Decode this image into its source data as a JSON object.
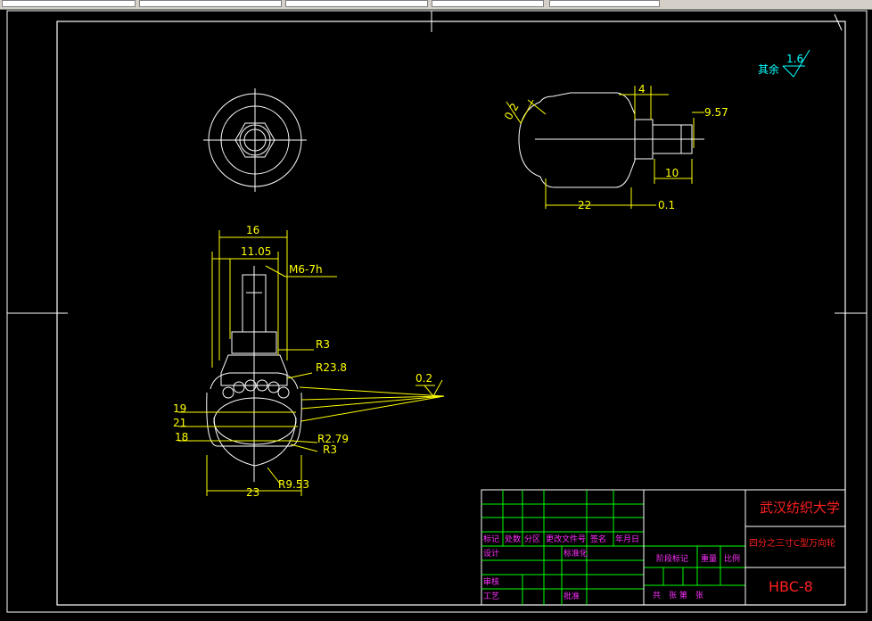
{
  "toolbar": {
    "cells": 6
  },
  "colors": {
    "background": "#000000",
    "outline": "#ffffff",
    "dimension": "#ffff00",
    "title_red": "#ff2020",
    "title_magenta": "#ff30ff",
    "table_line": "#00ff00",
    "cyan": "#00ffff"
  },
  "roughness": {
    "label": "其余",
    "value": "1.6"
  },
  "dimensions": {
    "d16": "16",
    "d11_05": "11.05",
    "thread": "M6-7h",
    "r3_top": "R3",
    "r23_8": "R23.8",
    "d19": "19",
    "d21": "21",
    "d18": "18",
    "r2_79": "R2.79",
    "r3_bottom": "R3",
    "r9_53": "R9.53",
    "d23": "23",
    "tol_side": "0.2",
    "tol_front": "0.2",
    "d4": "4",
    "d9_57": "9.57",
    "d10": "10",
    "d22": "22",
    "d0_1": "0.1"
  },
  "title_block": {
    "school": "武汉纺织大学",
    "part_name": "四分之三寸C型万向轮",
    "drawing_no": "HBC-8",
    "headers": [
      "标记",
      "处数",
      "分区",
      "更改文件号",
      "签名",
      "年月日"
    ],
    "design": "设计",
    "standardization": "标准化",
    "stage_mark": "阶段标记",
    "weight": "重量",
    "scale": "比例",
    "review": "审核",
    "process": "工艺",
    "approve": "批准",
    "sheets": "共　张 第　张"
  }
}
